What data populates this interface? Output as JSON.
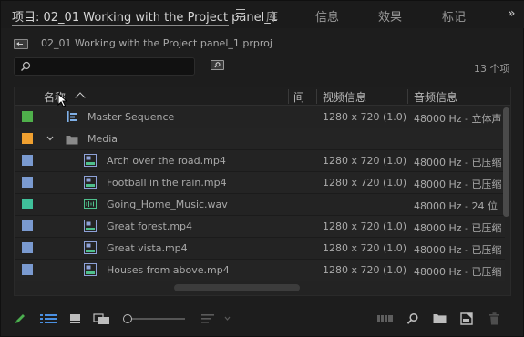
{
  "tabs": [
    {
      "label": "项目: 02_01 Working with the Project panel_1",
      "active": true
    },
    {
      "label": "库",
      "active": false
    },
    {
      "label": "信息",
      "active": false
    },
    {
      "label": "效果",
      "active": false
    },
    {
      "label": "标记",
      "active": false
    }
  ],
  "tab_overflow": "»",
  "project_file": "02_01 Working with the Project panel_1.prproj",
  "search": {
    "value": "",
    "placeholder": ""
  },
  "item_count": "13 个项",
  "columns": {
    "name": "名称",
    "gap": "间",
    "video_info": "视频信息",
    "audio_info": "音频信息"
  },
  "rows": [
    {
      "name": "Master Sequence",
      "video": "1280 x 720 (1.0)",
      "audio": "48000 Hz - 立体声",
      "color": "#4fb04b",
      "icon": "sequence-icon"
    },
    {
      "name": "Media",
      "video": "",
      "audio": "",
      "color": "#f0a030",
      "icon": "folder-icon"
    },
    {
      "name": "Arch over the road.mp4",
      "video": "1280 x 720 (1.0)",
      "audio": "48000 Hz - 已压缩",
      "color": "#7a9ad0",
      "icon": "video-clip-icon"
    },
    {
      "name": "Football in the rain.mp4",
      "video": "1280 x 720 (1.0)",
      "audio": "48000 Hz - 已压缩",
      "color": "#7a9ad0",
      "icon": "video-clip-icon"
    },
    {
      "name": "Going_Home_Music.wav",
      "video": "",
      "audio": "48000 Hz - 24 位 -",
      "color": "#3fc09a",
      "icon": "audio-clip-icon"
    },
    {
      "name": "Great forest.mp4",
      "video": "1280 x 720 (1.0)",
      "audio": "48000 Hz - 已压缩",
      "color": "#7a9ad0",
      "icon": "video-clip-icon"
    },
    {
      "name": "Great vista.mp4",
      "video": "1280 x 720 (1.0)",
      "audio": "48000 Hz - 已压缩",
      "color": "#7a9ad0",
      "icon": "video-clip-icon"
    },
    {
      "name": "Houses from above.mp4",
      "video": "1280 x 720 (1.0)",
      "audio": "48000 Hz - 已压缩",
      "color": "#7a9ad0",
      "icon": "video-clip-icon"
    }
  ],
  "colors": {
    "accent_pencil": "#4caf50",
    "list_view_icon": "#4a90e2"
  }
}
